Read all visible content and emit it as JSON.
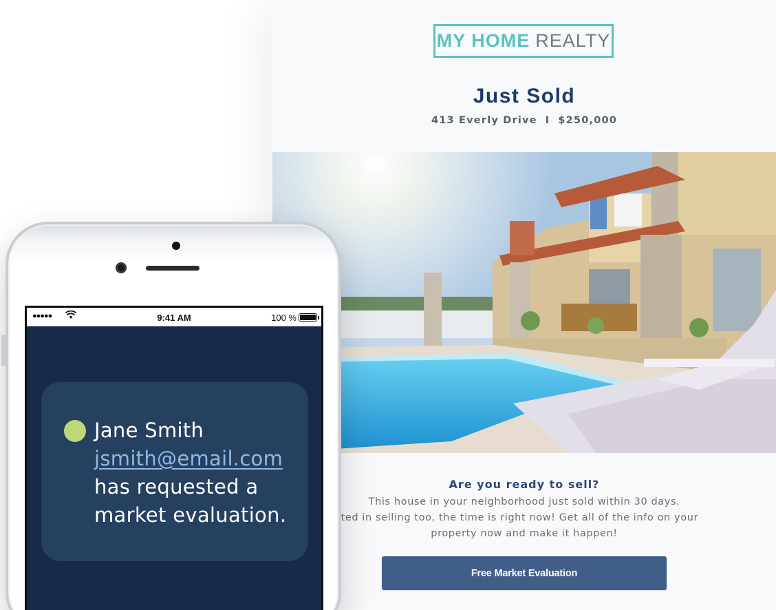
{
  "email": {
    "logo": {
      "bold": "MY HOME",
      "light": "REALTY"
    },
    "title": "Just Sold",
    "address": "413 Everly Drive",
    "separator": "I",
    "price": "$250,000",
    "question": "Are you ready to sell?",
    "body_line1": "This house in your neighborhood just sold within 30 days.",
    "body_line2": "are interested in selling too, the time is right now! Get all of the info on your",
    "body_line3": "property now and make it happen!",
    "cta_label": "Free Market Evaluation"
  },
  "phone": {
    "status": {
      "signal": "●●●●●",
      "time": "9:41 AM",
      "battery": "100 %"
    },
    "notification": {
      "name": "Jane Smith",
      "email": "jsmith@email.com",
      "line3": "has requested a",
      "line4": "market evaluation."
    }
  },
  "icons": [
    "wifi-icon",
    "battery-icon",
    "status-dot-icon"
  ],
  "colors": {
    "teal": "#5cc2bf",
    "navy": "#1d3a68",
    "button": "#405e87",
    "screen": "#172b48",
    "card": "#26415f",
    "dot": "#bcd878"
  }
}
